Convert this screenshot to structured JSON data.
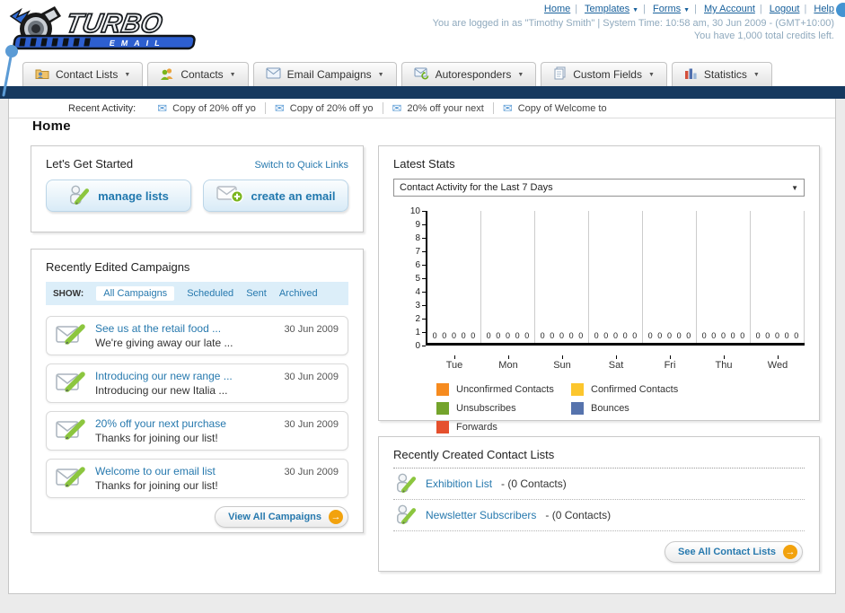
{
  "brand": {
    "name_top": "TURBO",
    "name_bottom": "EMAIL"
  },
  "colors": {
    "navy": "#16395f",
    "link_blue": "#2779ae",
    "brand_blue": "#2d5fd0",
    "arrow_orange": "#f2a20d"
  },
  "header": {
    "links": [
      {
        "label": "Home"
      },
      {
        "label": "Templates",
        "dropdown": true
      },
      {
        "label": "Forms",
        "dropdown": true
      },
      {
        "label": "My Account"
      },
      {
        "label": "Logout"
      },
      {
        "label": "Help"
      }
    ],
    "login_info": "You are logged in as \"Timothy Smith\" | System Time: 10:58 am, 30 Jun 2009 - (GMT+10:00)",
    "credits_info": "You have 1,000 total credits left."
  },
  "nav_tabs": [
    {
      "label": "Contact Lists",
      "icon": "contact-lists-icon"
    },
    {
      "label": "Contacts",
      "icon": "contacts-icon"
    },
    {
      "label": "Email Campaigns",
      "icon": "email-campaigns-icon"
    },
    {
      "label": "Autoresponders",
      "icon": "autoresponders-icon"
    },
    {
      "label": "Custom Fields",
      "icon": "custom-fields-icon"
    },
    {
      "label": "Statistics",
      "icon": "statistics-icon"
    }
  ],
  "recent_activity": {
    "label": "Recent Activity:",
    "items": [
      "Copy of 20% off yo",
      "Copy of 20% off yo",
      "20% off your next",
      "Copy of Welcome to"
    ]
  },
  "page_title": "Home",
  "get_started": {
    "title": "Let's Get Started",
    "switch_link": "Switch to Quick Links",
    "buttons": [
      {
        "label": "manage lists",
        "icon": "manage-lists-icon"
      },
      {
        "label": "create an email",
        "icon": "create-email-icon"
      }
    ]
  },
  "campaigns": {
    "title": "Recently Edited Campaigns",
    "show_label": "SHOW:",
    "filters": [
      {
        "label": "All Campaigns",
        "active": true
      },
      {
        "label": "Scheduled"
      },
      {
        "label": "Sent"
      },
      {
        "label": "Archived"
      }
    ],
    "items": [
      {
        "title": "See us at the retail food ...",
        "subtitle": "We're giving away our late ...",
        "date": "30 Jun 2009"
      },
      {
        "title": "Introducing our new range ...",
        "subtitle": "Introducing our new Italia ...",
        "date": "30 Jun 2009"
      },
      {
        "title": "20% off your next purchase",
        "subtitle": "Thanks for joining our list!",
        "date": "30 Jun 2009"
      },
      {
        "title": "Welcome to our email list",
        "subtitle": "Thanks for joining our list!",
        "date": "30 Jun 2009"
      }
    ],
    "view_all_label": "View All Campaigns"
  },
  "stats": {
    "title": "Latest Stats",
    "selected_option": "Contact Activity for the Last 7 Days"
  },
  "chart_data": {
    "type": "bar",
    "title": "Contact Activity for the Last 7 Days",
    "categories": [
      "Tue",
      "Mon",
      "Sun",
      "Sat",
      "Fri",
      "Thu",
      "Wed"
    ],
    "series": [
      {
        "name": "Unconfirmed Contacts",
        "color": "#f68b1f",
        "values": [
          0,
          0,
          0,
          0,
          0,
          0,
          0
        ]
      },
      {
        "name": "Confirmed Contacts",
        "color": "#fcc62d",
        "values": [
          0,
          0,
          0,
          0,
          0,
          0,
          0
        ]
      },
      {
        "name": "Unsubscribes",
        "color": "#74a42c",
        "values": [
          0,
          0,
          0,
          0,
          0,
          0,
          0
        ]
      },
      {
        "name": "Bounces",
        "color": "#5673ad",
        "values": [
          0,
          0,
          0,
          0,
          0,
          0,
          0
        ]
      },
      {
        "name": "Forwards",
        "color": "#e5502d",
        "values": [
          0,
          0,
          0,
          0,
          0,
          0,
          0
        ]
      }
    ],
    "xlabel": "",
    "ylabel": "",
    "ylim": [
      0,
      10
    ],
    "grid": "vertical-between-groups",
    "value_labels": true,
    "legend_position": "bottom"
  },
  "contact_lists": {
    "title": "Recently Created Contact Lists",
    "items": [
      {
        "name": "Exhibition List",
        "detail": "- (0 Contacts)"
      },
      {
        "name": "Newsletter Subscribers",
        "detail": "- (0 Contacts)"
      }
    ],
    "see_all_label": "See All Contact Lists"
  }
}
